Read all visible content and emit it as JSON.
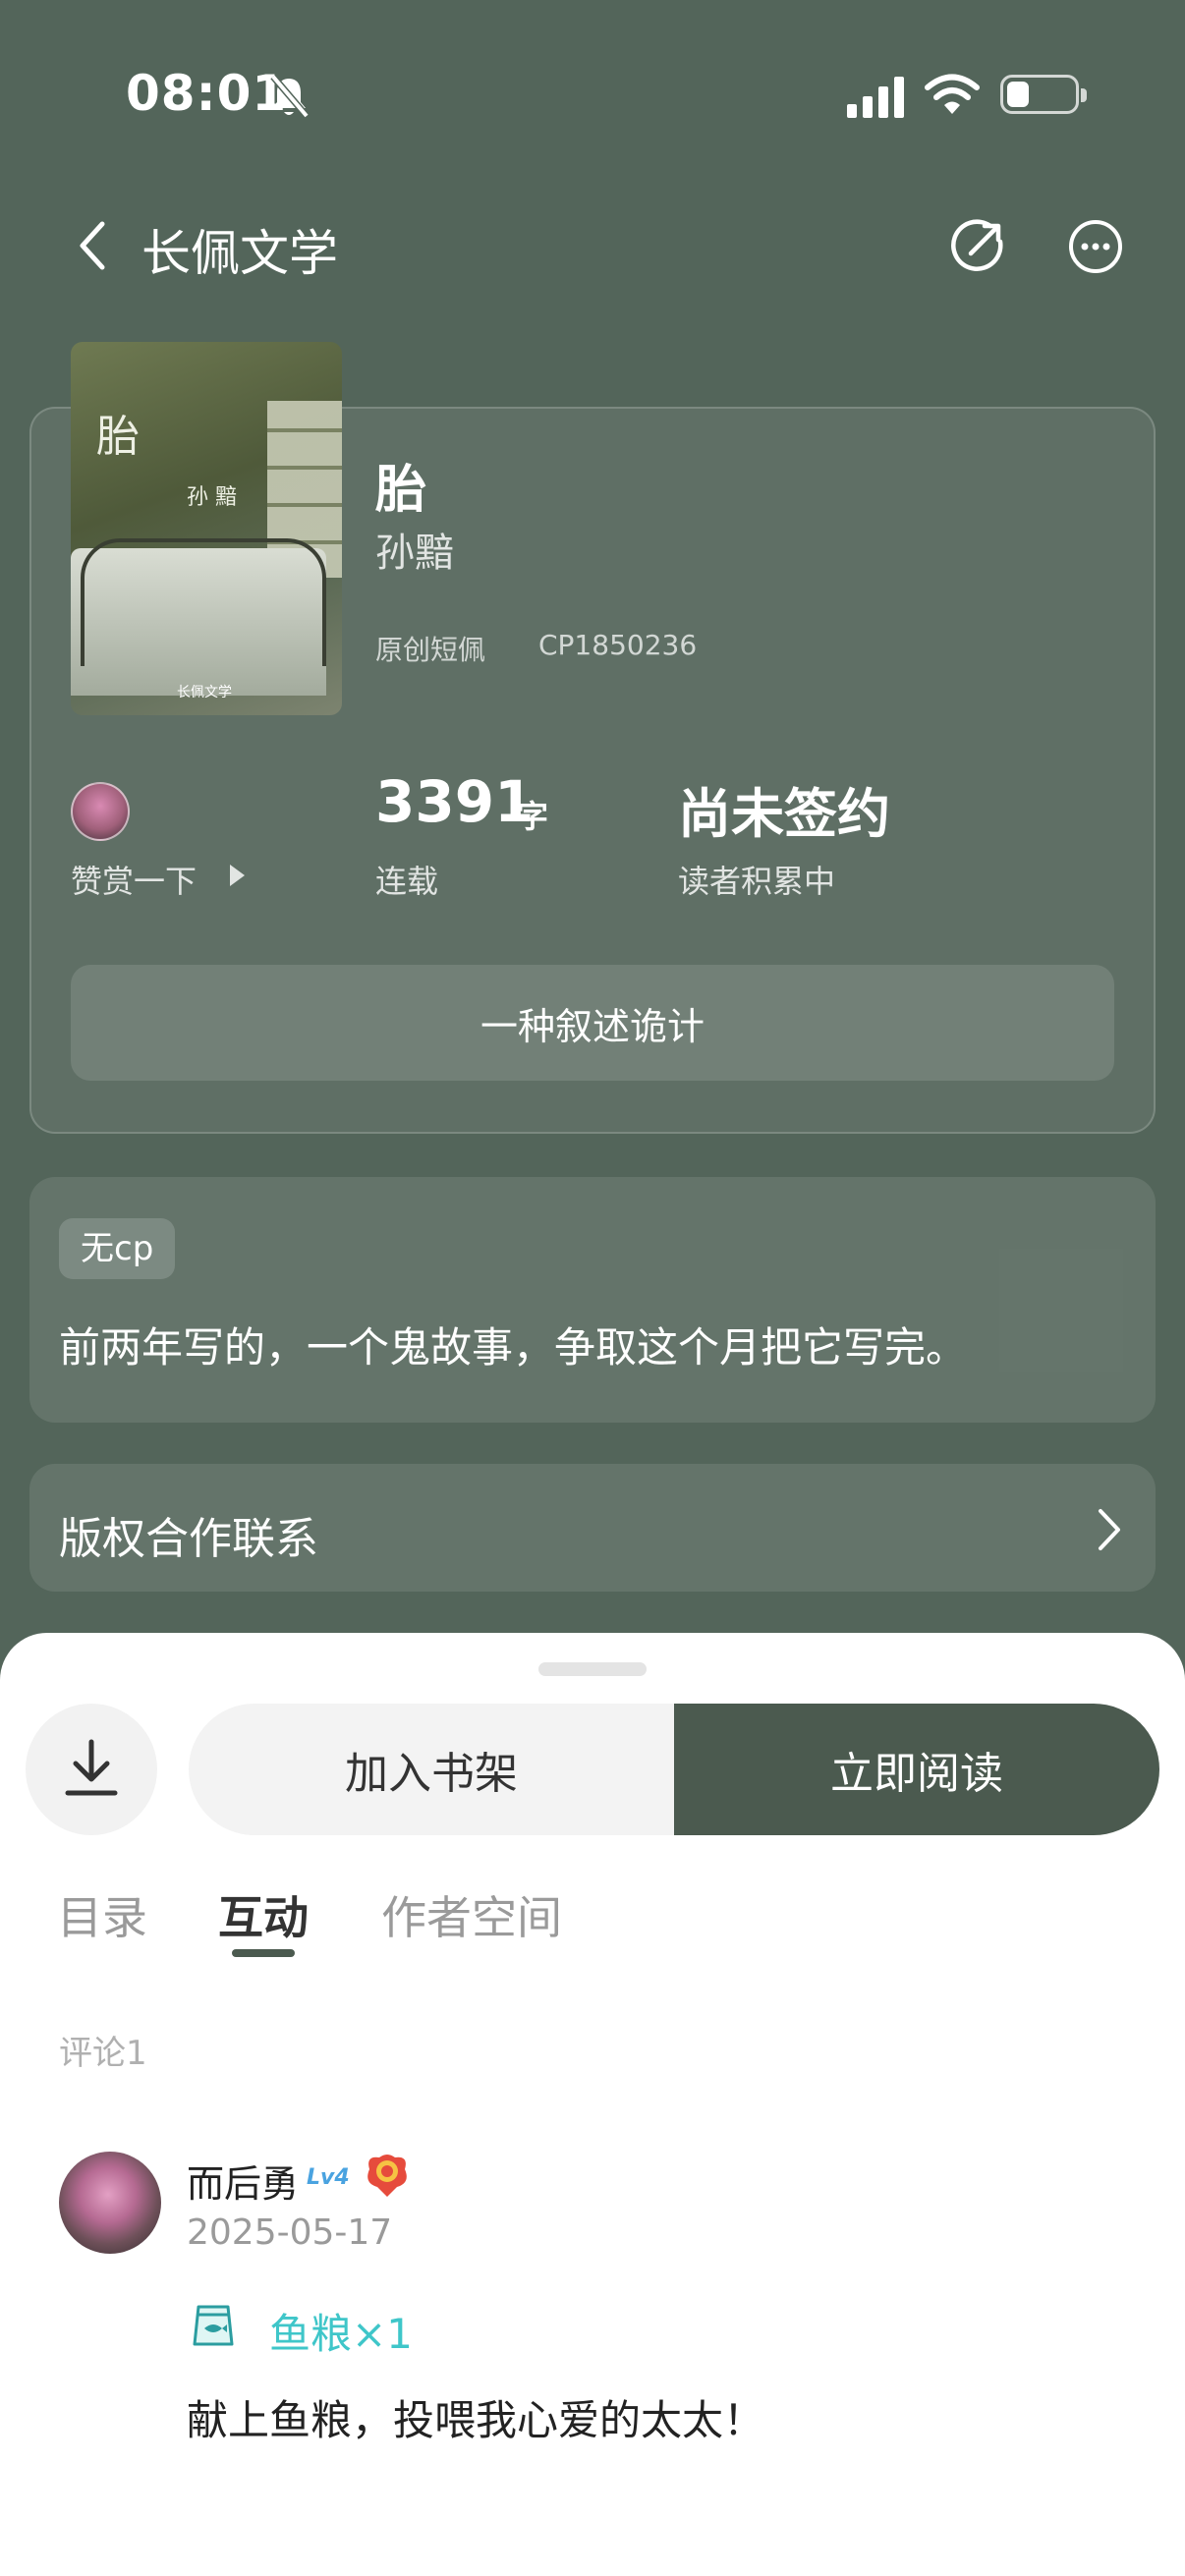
{
  "status_bar": {
    "time": "08:01"
  },
  "nav": {
    "title": "长佩文学"
  },
  "book": {
    "title": "胎",
    "author": "孙黯",
    "genre": "原创短佩",
    "cp_id": "CP1850236",
    "cover": {
      "title": "胎",
      "author": "孙 黯",
      "publisher": "长佩文学"
    }
  },
  "stats": {
    "tip_label": "赞赏一下",
    "words_value": "3391",
    "words_unit": "字",
    "words_status": "连载",
    "sign_value": "尚未签约",
    "sign_status": "读者积累中"
  },
  "tagline": "一种叙述诡计",
  "intro": {
    "tag": "无cp",
    "text": "前两年写的，一个鬼故事，争取这个月把它写完。"
  },
  "copyright": {
    "label": "版权合作联系"
  },
  "actions": {
    "shelf_label": "加入书架",
    "read_label": "立即阅读"
  },
  "tabs": [
    {
      "label": "目录",
      "active": false
    },
    {
      "label": "互动",
      "active": true
    },
    {
      "label": "作者空间",
      "active": false
    }
  ],
  "comments": {
    "count_label": "评论1",
    "items": [
      {
        "user": "而后勇",
        "level": "Lv4",
        "date": "2025-05-17",
        "gift": "鱼粮×1",
        "text": "献上鱼粮，投喂我心爱的太太！"
      }
    ]
  },
  "colors": {
    "header_bg": "#53655a",
    "accent": "#4b5a4f",
    "gift": "#3fc6c9"
  },
  "icons": [
    "bell-slash-icon",
    "signal-icon",
    "wifi-icon",
    "battery-icon",
    "back-icon",
    "share-icon",
    "more-icon",
    "play-arrow-icon",
    "chevron-right-icon",
    "download-icon",
    "gift-bag-icon",
    "medal-icon"
  ]
}
